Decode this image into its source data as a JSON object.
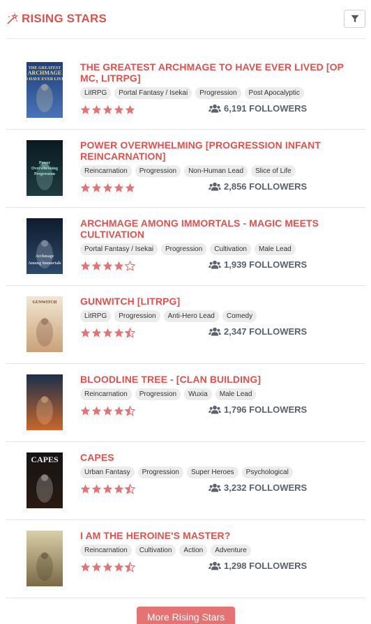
{
  "header": {
    "title": "RISING STARS"
  },
  "items": [
    {
      "title": "THE GREATEST ARCHMAGE TO HAVE EVER LIVED [OP MC, LITRPG]",
      "tags": [
        "LitRPG",
        "Portal Fantasy / Isekai",
        "Progression",
        "Post Apocalyptic"
      ],
      "rating": 5,
      "followers": "6,191 FOLLOWERS"
    },
    {
      "title": "POWER OVERWHELMING [PROGRESSION INFANT REINCARNATION]",
      "tags": [
        "Reincarnation",
        "Progression",
        "Non-Human Lead",
        "Slice of Life"
      ],
      "rating": 5,
      "followers": "2,856 FOLLOWERS"
    },
    {
      "title": "ARCHMAGE AMONG IMMORTALS - MAGIC MEETS CULTIVATION",
      "tags": [
        "Portal Fantasy / Isekai",
        "Progression",
        "Cultivation",
        "Male Lead"
      ],
      "rating": 4,
      "followers": "1,939 FOLLOWERS"
    },
    {
      "title": "GUNWITCH [LITRPG]",
      "tags": [
        "LitRPG",
        "Progression",
        "Anti-Hero Lead",
        "Comedy"
      ],
      "rating": 4.5,
      "followers": "2,347 FOLLOWERS"
    },
    {
      "title": "BLOODLINE TREE - [CLAN BUILDING]",
      "tags": [
        "Reincarnation",
        "Progression",
        "Wuxia",
        "Male Lead"
      ],
      "rating": 4.5,
      "followers": "1,796 FOLLOWERS"
    },
    {
      "title": "CAPES",
      "tags": [
        "Urban Fantasy",
        "Progression",
        "Super Heroes",
        "Psychological"
      ],
      "rating": 4.5,
      "followers": "3,232 FOLLOWERS"
    },
    {
      "title": "I AM THE HEROINE'S MASTER?",
      "tags": [
        "Reincarnation",
        "Cultivation",
        "Action",
        "Adventure"
      ],
      "rating": 4.5,
      "followers": "1,298 FOLLOWERS"
    }
  ],
  "covers": [
    {
      "lines": [
        "THE GREATEST",
        "ARCHMAGE",
        "TO HAVE EVER LIVED"
      ]
    },
    {
      "lines": [
        "Power",
        "Overwhelming",
        "Progression"
      ]
    },
    {
      "lines": [
        "Archmage",
        "Among Immortals"
      ]
    },
    {
      "lines": [
        "GUNWITCH"
      ]
    },
    {
      "lines": []
    },
    {
      "lines": [
        "CAPES"
      ]
    },
    {
      "lines": []
    }
  ],
  "more_button": {
    "label": "More Rising Stars"
  },
  "colors": {
    "accent": "#d9534f",
    "star": "#e57373",
    "button": "#e57373"
  }
}
